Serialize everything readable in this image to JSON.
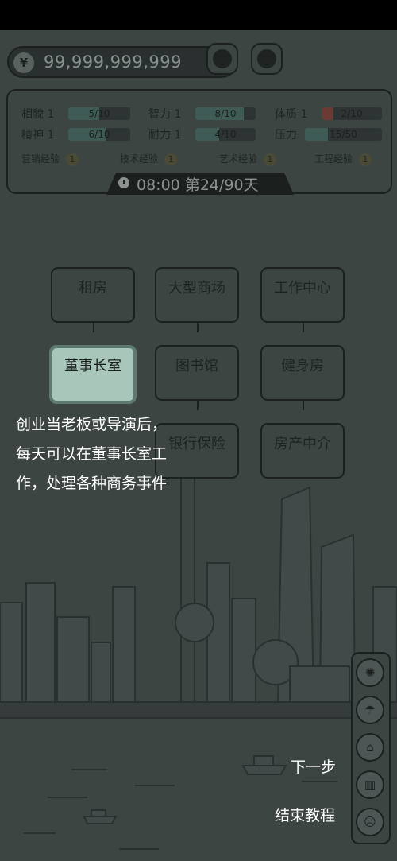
{
  "money": {
    "symbol": "¥",
    "value": "99,999,999,999"
  },
  "stats": {
    "row1": [
      {
        "label": "相貌",
        "level": "1",
        "bar": "5/10",
        "fraction": 0.5
      },
      {
        "label": "智力",
        "level": "1",
        "bar": "8/10",
        "fraction": 0.8
      },
      {
        "label": "体质",
        "level": "1",
        "bar": "2/10",
        "fraction": 0.2
      }
    ],
    "row2": [
      {
        "label": "精神",
        "level": "1",
        "bar": "6/10",
        "fraction": 0.6
      },
      {
        "label": "耐力",
        "level": "1",
        "bar": "4/10",
        "fraction": 0.4
      },
      {
        "label": "压力",
        "level": "",
        "bar": "15/50",
        "fraction": 0.3
      }
    ],
    "experience": [
      {
        "label": "营销经验",
        "value": "1"
      },
      {
        "label": "技术经验",
        "value": "1"
      },
      {
        "label": "艺术经验",
        "value": "1"
      },
      {
        "label": "工程经验",
        "value": "1"
      }
    ],
    "time": "08:00",
    "day": "第24/90天"
  },
  "locations": {
    "rent": "租房",
    "mall": "大型商场",
    "work_center": "工作中心",
    "boardroom": "董事长室",
    "library": "图书馆",
    "gym": "健身房",
    "hidden": "",
    "bank": "银行保险",
    "realty": "房产中介"
  },
  "tutorial": {
    "text": "创业当老板或导演后，每天可以在董事长室工作，处理各种商务事件",
    "next": "下一步",
    "end": "结束教程"
  },
  "side_icons": [
    "brain-icon",
    "umbrella-icon",
    "home-plus-icon",
    "chart-icon",
    "sad-face-icon"
  ],
  "colors": {
    "highlight": "#a9c6bb",
    "background": "#3d4543",
    "border": "#1b1f1e"
  }
}
